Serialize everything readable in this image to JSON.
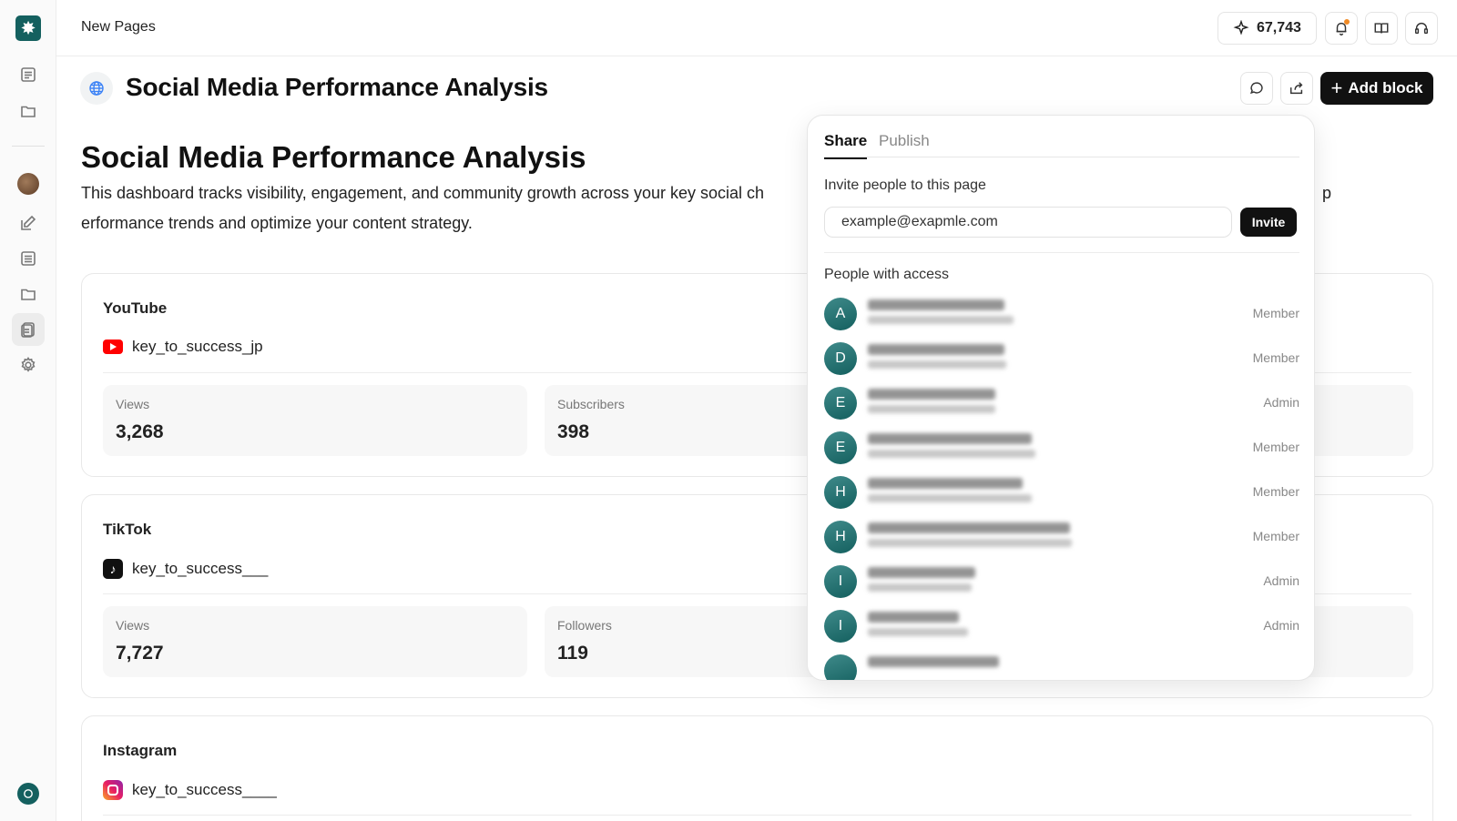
{
  "topbar": {
    "breadcrumb": "New Pages",
    "credits": "67,743"
  },
  "page": {
    "title": "Social Media Performance Analysis",
    "add_block_label": "Add block"
  },
  "document": {
    "heading": "Social Media Performance Analysis",
    "description_line1": "This dashboard tracks visibility, engagement, and community growth across your key social ch",
    "description_line1_tail": "p",
    "description_line2": "erformance trends and optimize your content strategy."
  },
  "cards": {
    "youtube": {
      "title": "YouTube",
      "handle": "key_to_success_jp",
      "stats": [
        {
          "label": "Views",
          "value": "3,268"
        },
        {
          "label": "Subscribers",
          "value": "398"
        }
      ]
    },
    "tiktok": {
      "title": "TikTok",
      "handle": "key_to_success___",
      "stats": [
        {
          "label": "Views",
          "value": "7,727"
        },
        {
          "label": "Followers",
          "value": "119"
        }
      ]
    },
    "instagram": {
      "title": "Instagram",
      "handle": "key_to_success____"
    }
  },
  "share_popover": {
    "tabs": [
      {
        "label": "Share",
        "active": true
      },
      {
        "label": "Publish",
        "active": false
      }
    ],
    "invite_label": "Invite people to this page",
    "email_value": "example@exapmle.com",
    "invite_button": "Invite",
    "access_label": "People with access",
    "people": [
      {
        "initial": "A",
        "role": "Member"
      },
      {
        "initial": "D",
        "role": "Member"
      },
      {
        "initial": "E",
        "role": "Admin"
      },
      {
        "initial": "E",
        "role": "Member"
      },
      {
        "initial": "H",
        "role": "Member"
      },
      {
        "initial": "H",
        "role": "Member"
      },
      {
        "initial": "I",
        "role": "Admin"
      },
      {
        "initial": "I",
        "role": "Admin"
      },
      {
        "initial": "",
        "role": ""
      }
    ]
  },
  "colors": {
    "brand": "#14605f",
    "primary_button": "#111111",
    "notification_dot": "#f08a24"
  }
}
